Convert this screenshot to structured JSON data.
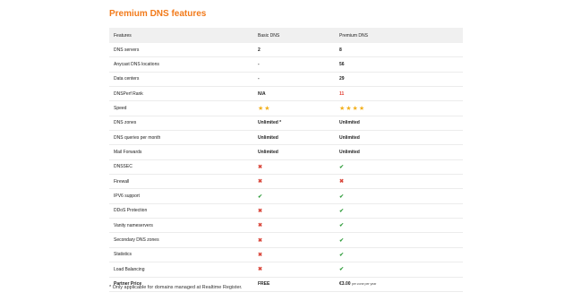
{
  "title": "Premium DNS features",
  "table": {
    "headers": [
      "Features",
      "Basic DNS",
      "Premium DNS"
    ],
    "rows": [
      {
        "feature": "DNS servers",
        "basic": "2",
        "premium": "8"
      },
      {
        "feature": "Anycast DNS locations",
        "basic": "-",
        "premium": "56"
      },
      {
        "feature": "Data centers",
        "basic": "-",
        "premium": "29"
      },
      {
        "feature": "DNSPerf Rank",
        "basic": "N/A",
        "premium": "11"
      },
      {
        "feature": "Speed",
        "basic": "★★",
        "premium": "★★★★"
      },
      {
        "feature": "DNS zones",
        "basic": "Unlimited *",
        "premium": "Unlimited"
      },
      {
        "feature": "DNS queries per month",
        "basic": "Unlimited",
        "premium": "Unlimited"
      },
      {
        "feature": "Mail Forwards",
        "basic": "Unlimited",
        "premium": "Unlimited"
      },
      {
        "feature": "DNSSEC",
        "basic": "✖",
        "premium": "✔"
      },
      {
        "feature": "Firewall",
        "basic": "✖",
        "premium": "✖"
      },
      {
        "feature": "IPV6 support",
        "basic": "✔",
        "premium": "✔"
      },
      {
        "feature": "DDoS Protection",
        "basic": "✖",
        "premium": "✔"
      },
      {
        "feature": "Vanity nameservers",
        "basic": "✖",
        "premium": "✔"
      },
      {
        "feature": "Secondary DNS zones",
        "basic": "✖",
        "premium": "✔"
      },
      {
        "feature": "Statistics",
        "basic": "✖",
        "premium": "✔"
      },
      {
        "feature": "Load Balancing",
        "basic": "✖",
        "premium": "✔"
      }
    ],
    "price_row": {
      "feature": "Partner Price",
      "basic": "FREE",
      "premium_amount": "€3.00",
      "premium_unit": "per zone per year"
    }
  },
  "footnote": "* Only applicable for domains managed at Realtime Register.",
  "colors": {
    "accent": "#f27a1a",
    "check": "#2e9b3a",
    "cross": "#d9463a",
    "star": "#f2b01e",
    "rank": "#e23b2e"
  }
}
